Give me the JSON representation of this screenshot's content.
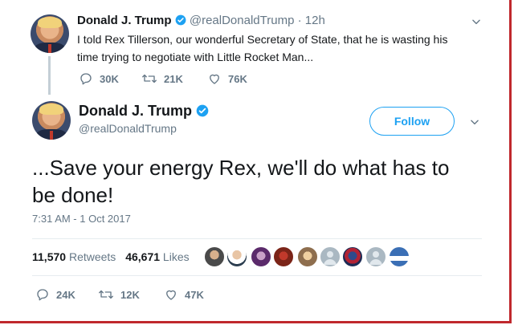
{
  "parent_tweet": {
    "name": "Donald J. Trump",
    "handle": "@realDonaldTrump",
    "separator": "·",
    "time": "12h",
    "text_line1": "I told Rex Tillerson, our wonderful Secretary of State, that he is wasting his",
    "text_line2": "time trying to negotiate with Little Rocket Man...",
    "actions": {
      "replies": "30K",
      "retweets": "21K",
      "likes": "76K"
    }
  },
  "main_tweet": {
    "name": "Donald J. Trump",
    "handle": "@realDonaldTrump",
    "follow_label": "Follow",
    "text_line1": "...Save your energy Rex, we'll do what has to",
    "text_line2": "be done!",
    "timestamp": "7:31 AM - 1 Oct 2017",
    "stats": {
      "retweets_count": "11,570",
      "retweets_label": "Retweets",
      "likes_count": "46,671",
      "likes_label": "Likes"
    },
    "actions": {
      "replies": "24K",
      "retweets": "12K",
      "likes": "47K"
    }
  },
  "colors": {
    "accent": "#1da1f2",
    "text": "#14171a",
    "muted": "#657786",
    "divider": "#e6ecf0",
    "frame": "#c0282d"
  },
  "icons": [
    "verified-badge-icon",
    "chevron-down-icon",
    "reply-icon",
    "retweet-icon",
    "like-icon"
  ]
}
